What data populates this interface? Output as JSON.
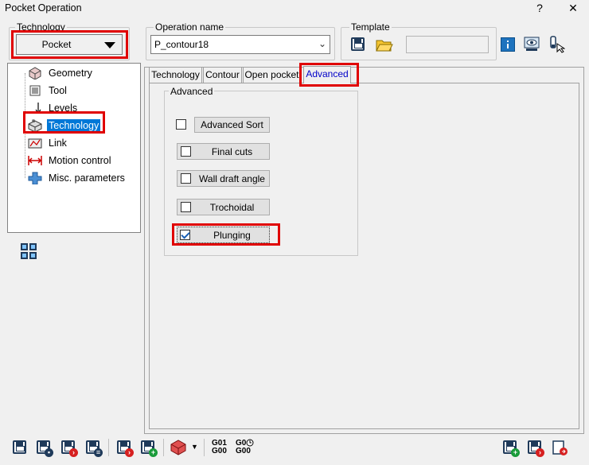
{
  "window": {
    "title": "Pocket Operation",
    "help": "?",
    "close": "✕"
  },
  "technology": {
    "label": "Technology",
    "value": "Pocket"
  },
  "operation": {
    "label": "Operation name",
    "value": "P_contour18"
  },
  "template": {
    "label": "Template"
  },
  "tree": {
    "items": [
      {
        "label": "Geometry",
        "icon": "geometry-icon"
      },
      {
        "label": "Tool",
        "icon": "tool-icon"
      },
      {
        "label": "Levels",
        "icon": "levels-icon"
      },
      {
        "label": "Technology",
        "icon": "technology-icon",
        "selected": true
      },
      {
        "label": "Link",
        "icon": "link-icon"
      },
      {
        "label": "Motion control",
        "icon": "motion-control-icon"
      },
      {
        "label": "Misc. parameters",
        "icon": "misc-parameters-icon"
      }
    ]
  },
  "tabs": [
    {
      "label": "Technology"
    },
    {
      "label": "Contour"
    },
    {
      "label": "Open pocket"
    },
    {
      "label": "Advanced",
      "active": true
    }
  ],
  "advanced": {
    "group_label": "Advanced",
    "options": [
      {
        "label": "Advanced Sort",
        "checked": false
      },
      {
        "label": "Final cuts",
        "checked": false
      },
      {
        "label": "Wall draft angle",
        "checked": false
      },
      {
        "label": "Trochoidal",
        "checked": false
      },
      {
        "label": "Plunging",
        "checked": true
      }
    ]
  },
  "toolbar": {
    "g_codes_1": "G01\nG00",
    "g_codes_2": "G0\nG00"
  },
  "colors": {
    "highlight": "#e00000",
    "selection": "#0078d7",
    "active_tab": "#0000c8"
  }
}
